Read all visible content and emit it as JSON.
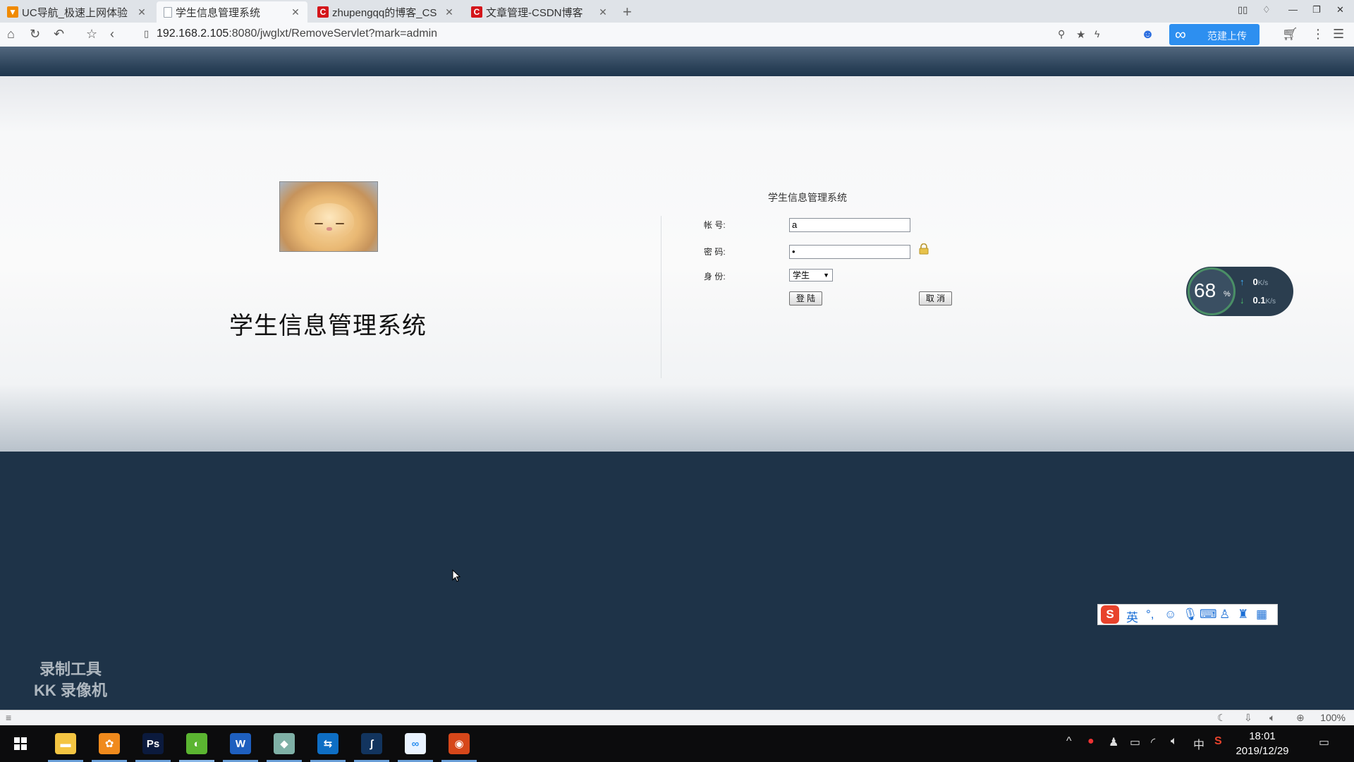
{
  "browser": {
    "tabs": [
      {
        "title": "UC导航_极速上网体验",
        "favicon_color": "#f08a00",
        "favicon_glyph": "▼",
        "active": false
      },
      {
        "title": "学生信息管理系统",
        "favicon_color": "#9aa3ad",
        "favicon_glyph": "",
        "active": true
      },
      {
        "title": "zhupengqq的博客_CS",
        "favicon_color": "#d4161b",
        "favicon_glyph": "C",
        "active": false
      },
      {
        "title": "文章管理-CSDN博客",
        "favicon_color": "#d4161b",
        "favicon_glyph": "C",
        "active": false
      }
    ],
    "new_tab_label": "+",
    "url_host": "192.168.2.105",
    "url_rest": ":8080/jwglxt/RemoveServlet?mark=admin",
    "upload_label": "范建上传",
    "zoom": "100%"
  },
  "login_page": {
    "hero_title": "学生信息管理系统",
    "form_title": "学生信息管理系统",
    "account_label": "帐 号:",
    "account_value": "a",
    "password_label": "密 码:",
    "password_value": "•",
    "role_label": "身 份:",
    "role_selected": "学生",
    "login_button": "登 陆",
    "cancel_button": "取 消"
  },
  "net_widget": {
    "percent": "68",
    "percent_unit": "%",
    "upload_speed": "0",
    "download_speed": "0.1",
    "speed_unit": "K/s"
  },
  "ime": {
    "mode_label": "英"
  },
  "watermark": {
    "line1": "录制工具",
    "line2": "KK 录像机"
  },
  "taskbar": {
    "apps": [
      {
        "name": "file-explorer",
        "color": "#f4c542",
        "glyph": "▬"
      },
      {
        "name": "app-orange",
        "color": "#f08a1c",
        "glyph": "✿"
      },
      {
        "name": "photoshop",
        "color": "#0b1a3d",
        "glyph": "Ps"
      },
      {
        "name": "app-green",
        "color": "#5bb531",
        "glyph": "◐"
      },
      {
        "name": "word",
        "color": "#1e5fbf",
        "glyph": "W"
      },
      {
        "name": "notes",
        "color": "#7fb0a6",
        "glyph": "◆"
      },
      {
        "name": "teamviewer",
        "color": "#0e6ec4",
        "glyph": "⇆"
      },
      {
        "name": "app-pen",
        "color": "#12345e",
        "glyph": "∫"
      },
      {
        "name": "baidu-cloud",
        "color": "#eaf3ff",
        "glyph": "∞"
      },
      {
        "name": "app-record",
        "color": "#d6471a",
        "glyph": "◉"
      }
    ],
    "tray_lang": "中",
    "time": "18:01",
    "date": "2019/12/29"
  }
}
